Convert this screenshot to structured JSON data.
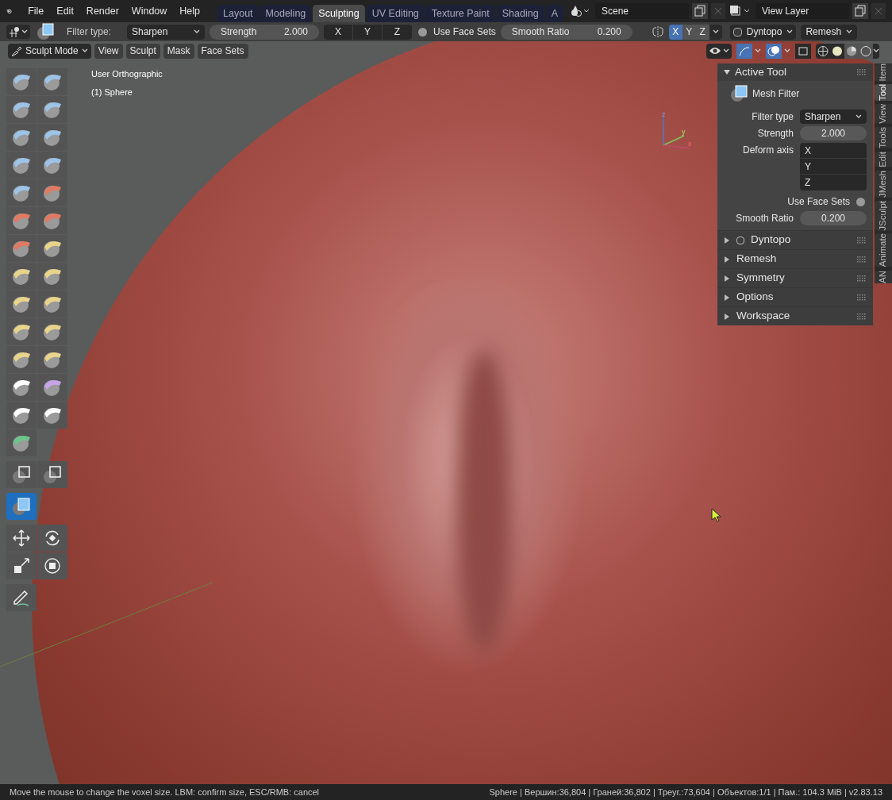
{
  "menu": [
    "File",
    "Edit",
    "Render",
    "Window",
    "Help"
  ],
  "workspaces": [
    {
      "label": "Layout",
      "selected": false
    },
    {
      "label": "Modeling",
      "selected": false
    },
    {
      "label": "Sculpting",
      "selected": true
    },
    {
      "label": "UV Editing",
      "selected": false
    },
    {
      "label": "Texture Paint",
      "selected": false
    },
    {
      "label": "Shading",
      "selected": false
    },
    {
      "label": "A",
      "selected": false
    }
  ],
  "scene": "Scene",
  "view_layer": "View Layer",
  "tool_header": {
    "filter_type_label": "Filter type:",
    "filter_type": "Sharpen",
    "strength": {
      "label": "Strength",
      "value": "2.000"
    },
    "axes": [
      {
        "label": "X"
      },
      {
        "label": "Y"
      },
      {
        "label": "Z"
      }
    ],
    "use_face_sets": {
      "label": "Use Face Sets",
      "checked": false
    },
    "smooth_ratio": {
      "label": "Smooth Ratio",
      "value": "0.200"
    },
    "symmetry": [
      {
        "label": "X",
        "selected": true
      },
      {
        "label": "Y",
        "selected": false
      },
      {
        "label": "Z",
        "selected": false
      }
    ],
    "dyntopo": {
      "label": "Dyntopo",
      "checked": false
    },
    "remesh": "Remesh"
  },
  "mode_bar": {
    "mode": "Sculpt Mode",
    "menus": [
      "View",
      "Sculpt",
      "Mask",
      "Face Sets"
    ]
  },
  "viewport": {
    "view_name": "User Orthographic",
    "object": "(1) Sphere",
    "gizmo": [
      "z",
      "y",
      "x"
    ]
  },
  "toolbar": [
    {
      "tools": [
        {
          "kind": "brush",
          "color": "#9dc3e6",
          "selected": false
        },
        {
          "kind": "brush",
          "color": "#9dc3e6",
          "selected": false
        },
        {
          "kind": "brush",
          "color": "#9dc3e6",
          "selected": false
        },
        {
          "kind": "brush",
          "color": "#9dc3e6",
          "selected": false
        },
        {
          "kind": "brush",
          "color": "#9dc3e6",
          "selected": false
        },
        {
          "kind": "brush",
          "color": "#9dc3e6",
          "selected": false
        },
        {
          "kind": "brush",
          "color": "#9dc3e6",
          "selected": false
        },
        {
          "kind": "brush",
          "color": "#9dc3e6",
          "selected": false
        },
        {
          "kind": "brush",
          "color": "#9dc3e6",
          "selected": false
        },
        {
          "kind": "brush",
          "color": "#e07a62",
          "selected": false
        },
        {
          "kind": "brush",
          "color": "#e07a62",
          "selected": false
        },
        {
          "kind": "brush",
          "color": "#e07a62",
          "selected": false
        },
        {
          "kind": "brush",
          "color": "#e07a62",
          "selected": false
        },
        {
          "kind": "brush",
          "color": "#e8d48a",
          "selected": false
        },
        {
          "kind": "brush",
          "color": "#e8d48a",
          "selected": false
        },
        {
          "kind": "brush",
          "color": "#e8d48a",
          "selected": false
        },
        {
          "kind": "brush",
          "color": "#e8d48a",
          "selected": false
        },
        {
          "kind": "brush",
          "color": "#e8d48a",
          "selected": false
        },
        {
          "kind": "brush",
          "color": "#e8d48a",
          "selected": false
        },
        {
          "kind": "brush",
          "color": "#e8d48a",
          "selected": false
        },
        {
          "kind": "brush",
          "color": "#e8d48a",
          "selected": false
        },
        {
          "kind": "brush",
          "color": "#e8d48a",
          "selected": false
        },
        {
          "kind": "brush",
          "color": "#ffffff",
          "selected": false
        },
        {
          "kind": "brush",
          "color": "#c9a3e8",
          "selected": false
        },
        {
          "kind": "brush",
          "color": "#ffffff",
          "selected": false
        },
        {
          "kind": "brush",
          "color": "#ffffff",
          "selected": false
        },
        {
          "kind": "brush",
          "color": "#6cc48a",
          "selected": false
        }
      ]
    },
    {
      "tools": [
        {
          "kind": "box",
          "selected": false
        },
        {
          "kind": "box",
          "selected": false
        }
      ]
    },
    {
      "tools": [
        {
          "kind": "filter",
          "selected": true
        }
      ]
    },
    {
      "tools": [
        {
          "kind": "move",
          "selected": false
        },
        {
          "kind": "rotate",
          "selected": false
        },
        {
          "kind": "scale",
          "selected": false
        },
        {
          "kind": "transform",
          "selected": false
        }
      ]
    },
    {
      "tools": [
        {
          "kind": "annotate",
          "selected": false
        }
      ]
    }
  ],
  "panel": {
    "title": "Active Tool",
    "expanded": true,
    "tool_name": "Mesh Filter",
    "filter_type": {
      "label": "Filter type",
      "value": "Sharpen"
    },
    "strength": {
      "label": "Strength",
      "value": "2.000"
    },
    "deform_axis": {
      "label": "Deform axis",
      "axes": [
        "X",
        "Y",
        "Z"
      ]
    },
    "use_face_sets": {
      "label": "Use Face Sets",
      "checked": false
    },
    "smooth_ratio": {
      "label": "Smooth Ratio",
      "value": "0.200"
    },
    "subpanels": [
      {
        "label": "Dyntopo",
        "expanded": false,
        "kind": "checkbox",
        "checked": false
      },
      {
        "label": "Remesh",
        "expanded": false,
        "kind": "plain"
      },
      {
        "label": "Symmetry",
        "expanded": false,
        "kind": "plain"
      },
      {
        "label": "Options",
        "expanded": false,
        "kind": "plain"
      },
      {
        "label": "Workspace",
        "expanded": false,
        "kind": "plain"
      }
    ]
  },
  "side_tabs": [
    {
      "label": "Item",
      "selected": false
    },
    {
      "label": "Tool",
      "selected": true
    },
    {
      "label": "View",
      "selected": false
    },
    {
      "label": "Tools",
      "selected": false
    },
    {
      "label": "Edit",
      "selected": false
    },
    {
      "label": "JMesh",
      "selected": false
    },
    {
      "label": "JSculpt",
      "selected": false
    },
    {
      "label": "Animate",
      "selected": false
    },
    {
      "label": "AN",
      "selected": false
    }
  ],
  "status": {
    "hint": "Move the mouse to change the voxel size. LBM: confirm size, ESC/RMB: cancel",
    "stats": "Sphere | Вершин:36,804 | Граней:36,802 | Треуг.:73,604 | Объектов:1/1 | Пам.: 104.3 MiB | v2.83.13"
  }
}
